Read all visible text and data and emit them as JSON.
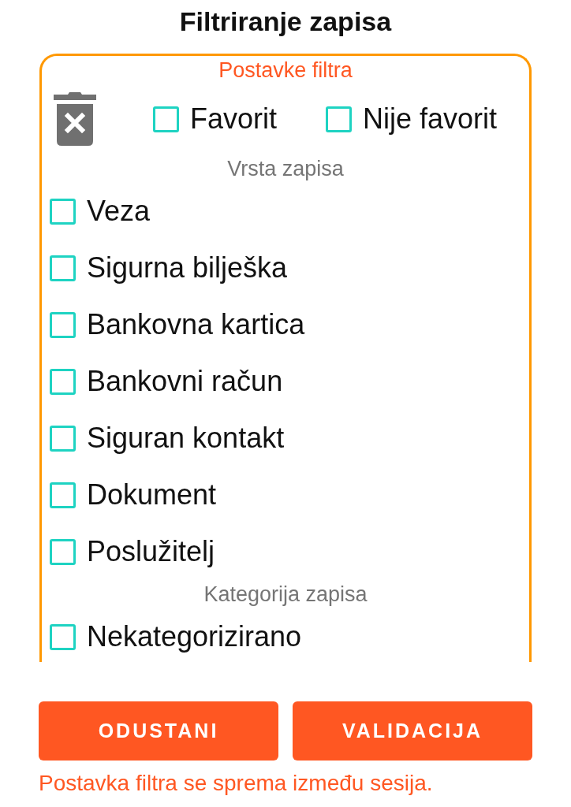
{
  "title": "Filtriranje zapisa",
  "filter_panel": {
    "heading": "Postavke filtra",
    "favorite_filters": [
      {
        "label": "Favorit",
        "checked": false
      },
      {
        "label": "Nije favorit",
        "checked": false
      }
    ],
    "sections": [
      {
        "heading": "Vrsta zapisa",
        "options": [
          {
            "label": "Veza",
            "checked": false
          },
          {
            "label": "Sigurna bilješka",
            "checked": false
          },
          {
            "label": "Bankovna kartica",
            "checked": false
          },
          {
            "label": "Bankovni račun",
            "checked": false
          },
          {
            "label": "Siguran kontakt",
            "checked": false
          },
          {
            "label": "Dokument",
            "checked": false
          },
          {
            "label": "Poslužitelj",
            "checked": false
          }
        ]
      },
      {
        "heading": "Kategorija zapisa",
        "options": [
          {
            "label": "Nekategorizirano",
            "checked": false
          }
        ]
      }
    ]
  },
  "buttons": [
    {
      "label": "ODUSTANI"
    },
    {
      "label": "VALIDACIJA"
    }
  ],
  "footer_note": "Postavka filtra se sprema između sesija."
}
